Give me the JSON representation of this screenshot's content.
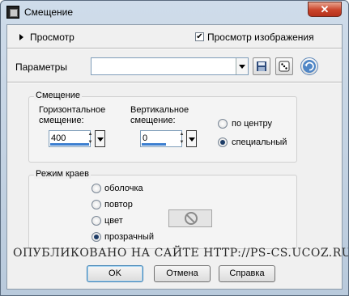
{
  "window": {
    "title": "Смещение",
    "close_label": "✕"
  },
  "preview": {
    "label": "Просмотр",
    "show_image_label": "Просмотр изображения",
    "show_image_checked": true
  },
  "presets": {
    "label": "Параметры",
    "value": ""
  },
  "offset_group": {
    "title": "Смещение",
    "horizontal_label_1": "Горизонтальное",
    "horizontal_label_2": "смещение:",
    "horizontal_value": "400",
    "vertical_label_1": "Вертикальное",
    "vertical_label_2": "смещение:",
    "vertical_value": "0",
    "centered_label": "по центру",
    "custom_label": "специальный",
    "selected": "custom"
  },
  "edge_group": {
    "title": "Режим краев",
    "options": [
      "оболочка",
      "повтор",
      "цвет",
      "прозрачный"
    ],
    "selected": "прозрачный"
  },
  "watermark": "ОПУБЛИКОВАНО   НА САЙТЕ   HTTP://PS-CS.UCOZ.RU",
  "buttons": {
    "ok": "OK",
    "cancel": "Отмена",
    "help": "Справка"
  },
  "colors": {
    "accent": "#3c7fd0",
    "close_button": "#c9432a"
  }
}
